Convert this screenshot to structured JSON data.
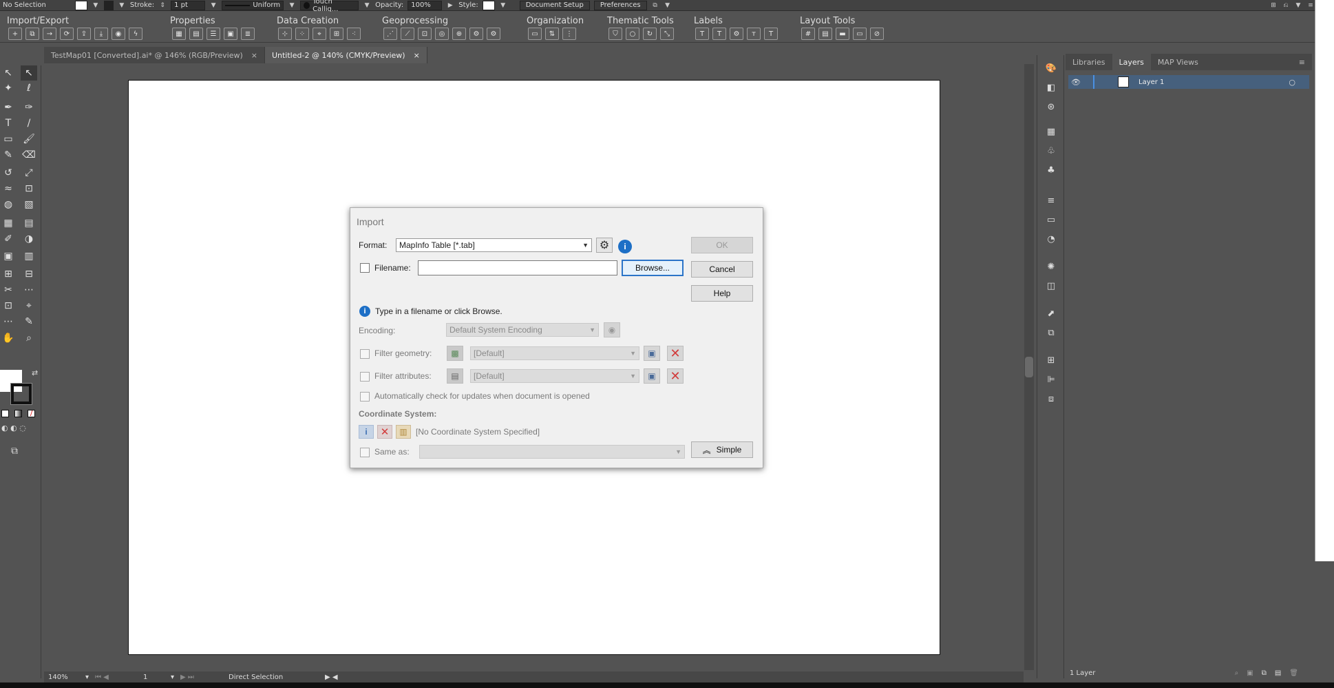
{
  "control_bar": {
    "selection": "No Selection",
    "stroke_label": "Stroke:",
    "stroke_weight": "1 pt",
    "stroke_profile": "Uniform",
    "brush": "Touch Callig...",
    "opacity_label": "Opacity:",
    "opacity_value": "100%",
    "style_label": "Style:",
    "document_setup": "Document Setup",
    "preferences": "Preferences"
  },
  "extension_bar": {
    "categories": [
      "Import/Export",
      "Properties",
      "Data Creation",
      "Geoprocessing",
      "Organization",
      "Thematic Tools",
      "Labels",
      "Layout Tools"
    ]
  },
  "doc_tabs": [
    {
      "label": "TestMap01 [Converted].ai* @ 146% (RGB/Preview)",
      "close": "×"
    },
    {
      "label": "Untitled-2 @ 140% (CMYK/Preview)",
      "close": "×"
    }
  ],
  "panel": {
    "tabs": [
      "Libraries",
      "Layers",
      "MAP Views"
    ],
    "layer_name": "Layer 1",
    "footer": "1 Layer"
  },
  "status_bar": {
    "zoom": "140%",
    "artboard": "1",
    "tool": "Direct Selection"
  },
  "dialog": {
    "title": "Import",
    "format_label": "Format:",
    "format_value": "MapInfo Table [*.tab]",
    "filename_label": "Filename:",
    "filename_value": "",
    "browse": "Browse...",
    "ok": "OK",
    "cancel": "Cancel",
    "help": "Help",
    "hint": "Type in a filename or click Browse.",
    "encoding_label": "Encoding:",
    "encoding_value": "Default System Encoding",
    "filter_geometry_label": "Filter geometry:",
    "filter_geometry_value": "[Default]",
    "filter_attributes_label": "Filter attributes:",
    "filter_attributes_value": "[Default]",
    "auto_check_label": "Automatically check for updates when document is opened",
    "coord_heading": "Coordinate System:",
    "coord_value": "[No Coordinate System Specified]",
    "same_as_label": "Same as:",
    "simple": "Simple"
  }
}
